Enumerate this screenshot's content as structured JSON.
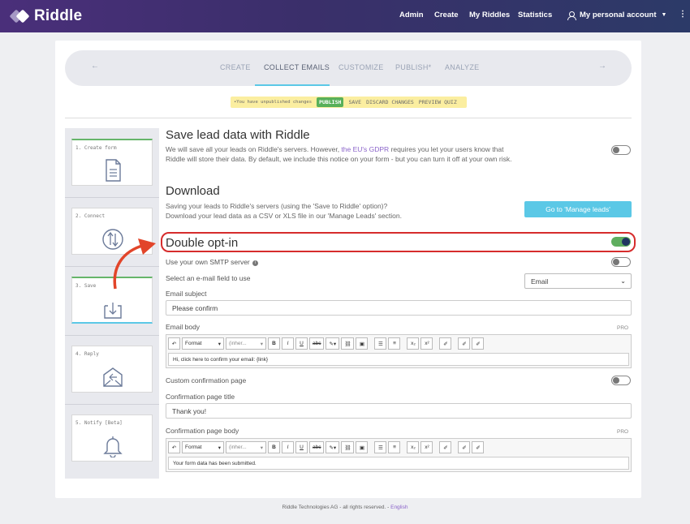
{
  "topbar": {
    "brand": "Riddle",
    "nav": [
      "Admin",
      "Create",
      "My Riddles",
      "Statistics"
    ],
    "account": "My personal account"
  },
  "steps": {
    "tabs": [
      "CREATE",
      "COLLECT EMAILS",
      "CUSTOMIZE",
      "PUBLISH*",
      "ANALYZE"
    ],
    "active": "COLLECT EMAILS"
  },
  "unpublished": {
    "message": "•You have unpublished changes",
    "publish": "PUBLISH",
    "save": "SAVE",
    "discard": "DISCARD CHANGES",
    "preview": "PREVIEW QUIZ"
  },
  "sidebar": {
    "items": [
      "1. Create form",
      "2. Connect",
      "3. Save",
      "4. Reply",
      "5. Notify [Beta]"
    ]
  },
  "save_lead": {
    "title": "Save lead data with Riddle",
    "desc_pre": "We will save all your leads on Riddle's servers. However, ",
    "desc_link": "the EU's GDPR",
    "desc_post": " requires you let your users know that Riddle will store their data. By default, we include this notice on your form - but you can turn it off at your own risk."
  },
  "download": {
    "title": "Download",
    "desc_1": "Saving your leads to Riddle's servers (using the 'Save to Riddle' option)?",
    "desc_2": "Download your lead data as a CSV or XLS file in our 'Manage Leads' section.",
    "button": "Go to 'Manage leads'"
  },
  "optin": {
    "title": "Double opt-in",
    "smtp": "Use your own SMTP server",
    "select_label": "Select an e-mail field to use",
    "select_value": "Email",
    "subject_label": "Email subject",
    "subject_value": "Please confirm",
    "body_label": "Email body",
    "pro": "PRO",
    "body_value": "Hi, click here to confirm your email: {link}",
    "custom_page": "Custom confirmation page",
    "page_title_label": "Confirmation page title",
    "page_title_value": "Thank you!",
    "page_body_label": "Confirmation page body",
    "page_body_value": "Your form data has been submitted."
  },
  "editor": {
    "format": "Format",
    "inherit": "(inher..."
  },
  "footer": {
    "text": "Riddle Technologies AG - all rights reserved. - ",
    "lang": "English"
  },
  "colors": {
    "accent": "#5bc8e6",
    "highlight": "#d62c2c",
    "toggle_on": "#5fae5f"
  }
}
